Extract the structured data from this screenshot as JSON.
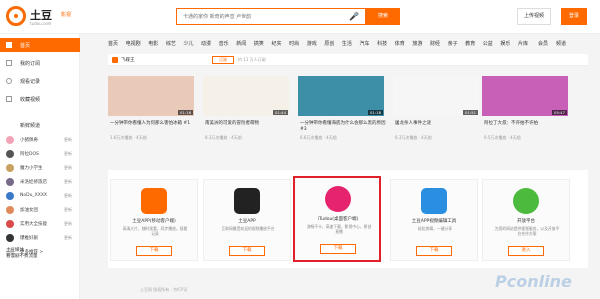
{
  "header": {
    "logo": "土豆",
    "logo_domain": "tudou.com",
    "logo_sub": "影视",
    "search_placeholder": "卡通的家你 新奇的声音 卢世韵",
    "search_button": "搜索",
    "upload_button": "上传视频",
    "login_button": "登录"
  },
  "sidebar": {
    "items": [
      {
        "label": "首页"
      },
      {
        "label": "我的订阅"
      },
      {
        "label": "观看记录"
      },
      {
        "label": "收藏视频"
      }
    ],
    "section_title": "新鲜频道",
    "subs": [
      {
        "name": "小猪佩奇",
        "tag": "更新"
      },
      {
        "name": "阿拉DOS",
        "tag": "更新"
      },
      {
        "name": "魔力小学生",
        "tag": "更新"
      },
      {
        "name": "米洛娃修旅店",
        "tag": "更新"
      },
      {
        "name": "NoDu_XXXX",
        "tag": "更新"
      },
      {
        "name": "加油女团",
        "tag": "更新"
      },
      {
        "name": "实用大全技能",
        "tag": "更新"
      },
      {
        "name": "爆推好剧",
        "tag": "更新"
      },
      {
        "name": "更多推荐 >",
        "tag": ""
      }
    ],
    "bottom_lines": [
      "土豆媒体",
      "看漫剧不费流量"
    ]
  },
  "nav": {
    "items": [
      "首页",
      "电视剧",
      "电影",
      "综艺",
      "少儿",
      "动漫",
      "音乐",
      "新闻",
      "搞笑",
      "纪实",
      "时尚",
      "游戏",
      "原创",
      "生活",
      "汽车",
      "科技",
      "体育",
      "旅游",
      "财经",
      "亲子",
      "教育",
      "公益",
      "娱乐",
      "片库"
    ],
    "right": [
      "会员",
      "频道"
    ]
  },
  "feed": {
    "name": "飞碟王",
    "follow": "订阅",
    "meta": "约 11 万人订阅"
  },
  "videos": [
    {
      "title": "一分钟带你看懂人为何那么害怕冰箱 #1",
      "meta": "1.6万次播放 · 4天前",
      "duration": "01:18"
    },
    {
      "title": "南美洲的可爱的冒险者萌物",
      "meta": "8.3万次播放 · 4天前",
      "duration": "01:44"
    },
    {
      "title": "一分钟带你看懂海底为什么会那么黑的原因 #3",
      "meta": "6.6万次播放 · 4天前",
      "duration": "01:18"
    },
    {
      "title": "屠龙杀人事件之谜",
      "meta": "6.3万次播放 · 4天前",
      "duration": "01:51"
    },
    {
      "title": "阿拉丁大叔：不许拍不许拍",
      "meta": "9.5万次播放 · 4天前",
      "duration": "05:47"
    }
  ],
  "apps": [
    {
      "title": "土豆APP(移动客户端)",
      "desc": "高清大片，随时观看，同步播放，观看记录",
      "button": "下载",
      "color": "#ff6a00"
    },
    {
      "title": "土豆APP",
      "desc": "互联网最受欢迎的视频播放平台",
      "button": "下载",
      "color": "#222222"
    },
    {
      "title": "iTudou(桌面客户端)",
      "desc": "流畅不卡，高速下载，影视中心，原创直播",
      "button": "下载",
      "color": "#e6246e"
    },
    {
      "title": "土豆APP视频编辑工具",
      "desc": "轻松剪辑，一键分享",
      "button": "下载",
      "color": "#2a8fe0"
    },
    {
      "title": "开放平台",
      "desc": "为您的网站提供视频服务，以及开放平台合作方案",
      "button": "进入",
      "color": "#4cba3c"
    }
  ],
  "footer": "土豆网 版权所有 · 京ICP证",
  "watermark": "Pconline"
}
